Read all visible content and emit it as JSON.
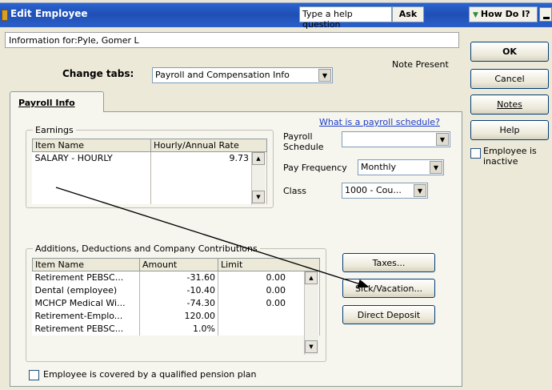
{
  "window": {
    "title": "Edit Employee"
  },
  "help": {
    "placeholder": "Type a help question",
    "ask_label": "Ask",
    "how_do_i_label": "How Do I?"
  },
  "info": {
    "information_for": "Information for:Pyle, Gomer L",
    "note_present": "Note Present"
  },
  "change_tabs": {
    "label": "Change tabs:",
    "selected": "Payroll and Compensation Info"
  },
  "tab": {
    "label": "Payroll Info"
  },
  "earnings": {
    "legend": "Earnings",
    "columns": [
      "Item Name",
      "Hourly/Annual Rate"
    ],
    "rows": [
      {
        "item": "SALARY - HOURLY",
        "rate": "9.73"
      }
    ]
  },
  "schedule": {
    "link": "What is a payroll schedule?",
    "payroll_label_1": "Payroll",
    "payroll_label_2": "Schedule",
    "payroll_value": "",
    "frequency_label": "Pay Frequency",
    "frequency_value": "Monthly",
    "class_label": "Class",
    "class_value": "1000 - Cou..."
  },
  "additions": {
    "legend": "Additions, Deductions and Company Contributions",
    "columns": [
      "Item Name",
      "Amount",
      "Limit"
    ],
    "rows": [
      {
        "item": "Retirement PEBSC...",
        "amount": "-31.60",
        "limit": "0.00"
      },
      {
        "item": "Dental (employee)",
        "amount": "-10.40",
        "limit": "0.00"
      },
      {
        "item": "MCHCP Medical Wi...",
        "amount": "-74.30",
        "limit": "0.00"
      },
      {
        "item": "Retirement-Emplo...",
        "amount": "120.00",
        "limit": ""
      },
      {
        "item": "Retirement PEBSC...",
        "amount": "1.0%",
        "limit": ""
      }
    ]
  },
  "buttons": {
    "taxes": "Taxes...",
    "sick_vacation": "Sick/Vacation...",
    "direct_deposit": "Direct Deposit",
    "ok": "OK",
    "cancel": "Cancel",
    "notes": "Notes",
    "help": "Help"
  },
  "pension_checkbox": "Employee is covered by a qualified pension plan",
  "inactive_checkbox": "Employee is inactive",
  "colors": {
    "title_bar": "#1f4fb5",
    "link": "#1a3cc8",
    "dialog_bg": "#ece9d8"
  }
}
